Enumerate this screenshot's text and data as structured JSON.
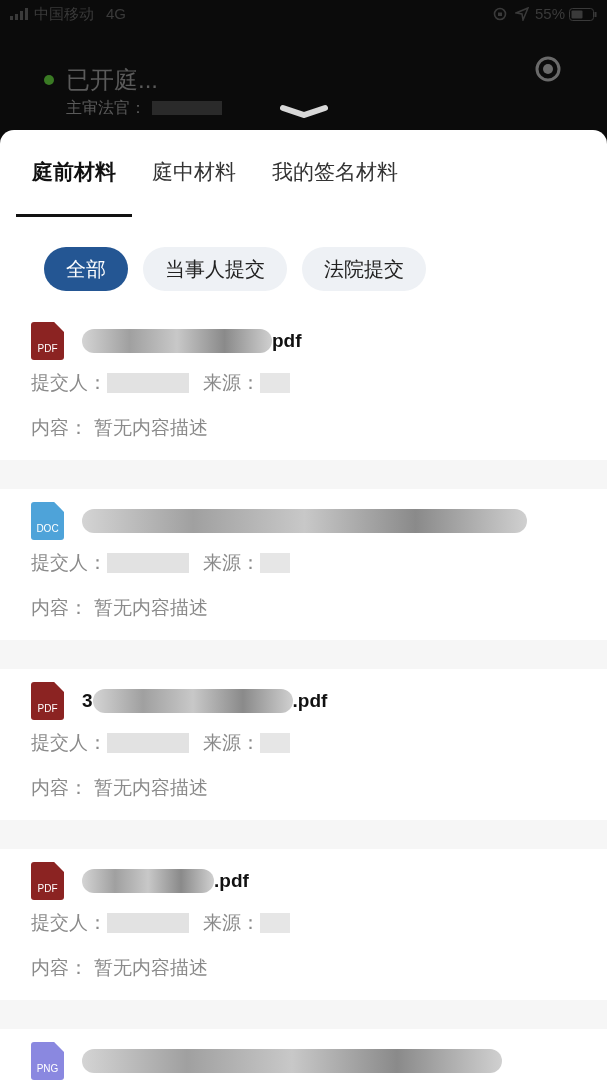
{
  "status_bar": {
    "carrier": "中国移动",
    "network": "4G",
    "battery": "55%"
  },
  "header": {
    "status": "已开庭...",
    "judge_label": "主审法官："
  },
  "tabs": [
    {
      "label": "庭前材料",
      "selected": true
    },
    {
      "label": "庭中材料",
      "selected": false
    },
    {
      "label": "我的签名材料",
      "selected": false
    }
  ],
  "filters": [
    {
      "label": "全部",
      "selected": true
    },
    {
      "label": "当事人提交",
      "selected": false
    },
    {
      "label": "法院提交",
      "selected": false
    }
  ],
  "files": [
    {
      "type": "PDF",
      "name_suffix": "pdf",
      "submitter_label": "提交人：",
      "source_label": "来源：",
      "content_label": "内容：",
      "content": "暂无内容描述"
    },
    {
      "type": "DOC",
      "submitter_label": "提交人：",
      "source_label": "来源：",
      "content_label": "内容：",
      "content": "暂无内容描述"
    },
    {
      "type": "PDF",
      "name_prefix": "3",
      "name_suffix": ".pdf",
      "submitter_label": "提交人：",
      "source_label": "来源：",
      "content_label": "内容：",
      "content": "暂无内容描述"
    },
    {
      "type": "PDF",
      "name_suffix": ".pdf",
      "submitter_label": "提交人：",
      "source_label": "来源：",
      "content_label": "内容：",
      "content": "暂无内容描述"
    },
    {
      "type": "PNG"
    }
  ]
}
